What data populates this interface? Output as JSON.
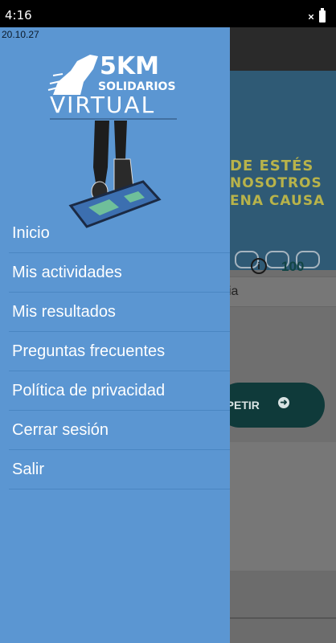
{
  "status_bar": {
    "time": "4:16"
  },
  "drawer": {
    "timestamp": "20.10.27",
    "logo": {
      "line1": "5KM",
      "line2": "SOLIDARIOS",
      "line3": "VIRTUAL"
    },
    "menu": [
      {
        "label": "Inicio"
      },
      {
        "label": "Mis actividades"
      },
      {
        "label": "Mis resultados"
      },
      {
        "label": "Preguntas frecuentes"
      },
      {
        "label": "Política de privacidad"
      },
      {
        "label": "Cerrar sesión"
      },
      {
        "label": "Salir"
      }
    ]
  },
  "background": {
    "banner_lines": [
      "DE ESTÉS",
      "NOSOTROS",
      "ENA CAUSA"
    ],
    "info_icon": "info-circle-icon",
    "count": "100",
    "strip_text": "ia",
    "button_label": "MPETIR",
    "button_icon": "arrow-right-circle-icon"
  }
}
